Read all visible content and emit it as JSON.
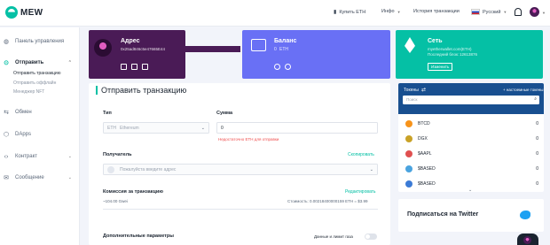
{
  "brand": {
    "name": "MEW"
  },
  "topnav": {
    "buy_eth": "Купить ETH",
    "info": "Инфо",
    "history": "История транзакции",
    "language": "Русский"
  },
  "sidebar": {
    "items": [
      {
        "label": "Панель управления"
      },
      {
        "label": "Отправить"
      },
      {
        "label": "Обмен"
      },
      {
        "label": "DApps"
      },
      {
        "label": "Контракт"
      },
      {
        "label": "Сообщение"
      }
    ],
    "subitems": [
      {
        "label": "Отправить транзакцию"
      },
      {
        "label": "Отправить оффлайн"
      },
      {
        "label": "Менеджер NFT"
      }
    ]
  },
  "address_card": {
    "title": "Адрес",
    "value": "0x25ad846c5e47665E44298d1f2e3238BF00042",
    "color": "#4a1b56"
  },
  "balance_card": {
    "title": "Баланс",
    "amount": "0",
    "unit": "ETH",
    "color": "#6970f5"
  },
  "network_card": {
    "title": "Сеть",
    "node": "myetherwallet.com(ETH)",
    "last_block_label": "Последний блок:",
    "last_block": "12613876",
    "change_label": "Изменить",
    "color": "#05c0a5"
  },
  "send": {
    "title": "Отправить транзакцию",
    "type_label": "Тип",
    "type_value": "ETH",
    "type_sub": "Ethereum",
    "amount_label": "Сумма",
    "amount_value": "0",
    "amount_error": "Недостаточно ETH для отправки",
    "to_label": "Получатель",
    "copy_label": "Скопировать",
    "to_placeholder": "Пожалуйста введите адрес",
    "fee_label": "Комиссия за транзакцию",
    "edit_label": "Редактировать",
    "gas_price": "~104.00 Gwei",
    "cost": "Стоимость: 0.00218400000159 ETH = $3.99",
    "advanced_label": "Дополнительные параметры",
    "gas_limit_label": "Данные и лимит газа"
  },
  "tokens": {
    "title": "Токены",
    "custom_label": "+ настоемные токены",
    "search_placeholder": "Поиск",
    "header_color": "#184f90",
    "list": [
      {
        "symbol": "BTCD",
        "value": "0",
        "color": "#f7931a"
      },
      {
        "symbol": "DGX",
        "value": "0",
        "color": "#c9a227"
      },
      {
        "symbol": "$AAPL",
        "value": "0",
        "color": "#e05050"
      },
      {
        "symbol": "$BASED",
        "value": "0",
        "color": "#4aa3df"
      },
      {
        "symbol": "$BASED",
        "value": "0",
        "color": "#3b7bd6"
      }
    ]
  },
  "twitter": {
    "label": "Подписаться на Twitter"
  }
}
